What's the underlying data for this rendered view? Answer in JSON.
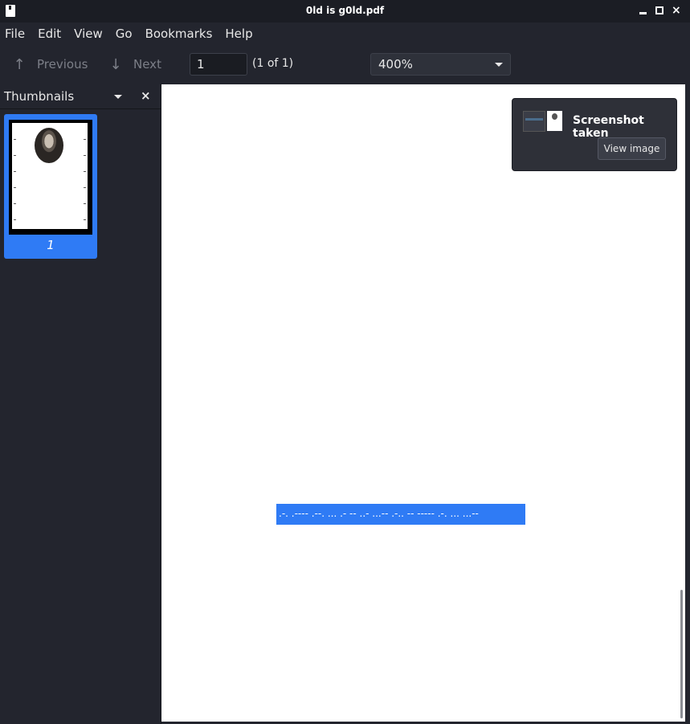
{
  "window": {
    "title": "0ld is g0ld.pdf",
    "close_glyph": "×"
  },
  "menubar": {
    "items": [
      "File",
      "Edit",
      "View",
      "Go",
      "Bookmarks",
      "Help"
    ]
  },
  "toolbar": {
    "previous_label": "Previous",
    "next_label": "Next",
    "previous_icon": "arrow-up-icon",
    "next_icon": "arrow-down-icon",
    "page_value": "1",
    "page_count": "(1 of 1)",
    "zoom": "400%"
  },
  "sidebar": {
    "label": "Thumbnails",
    "close_glyph": "×",
    "thumbnails": [
      {
        "page_label": "1"
      }
    ]
  },
  "document": {
    "selected_text": ".-. .---- .--. ... .- -- ..- ...-- .-.. -- ----- .-. ... ...--"
  },
  "notification": {
    "title": "Screenshot taken",
    "button_label": "View image"
  },
  "colors": {
    "selection": "#2f7bf5",
    "background": "#23252e",
    "page": "#ffffff"
  }
}
